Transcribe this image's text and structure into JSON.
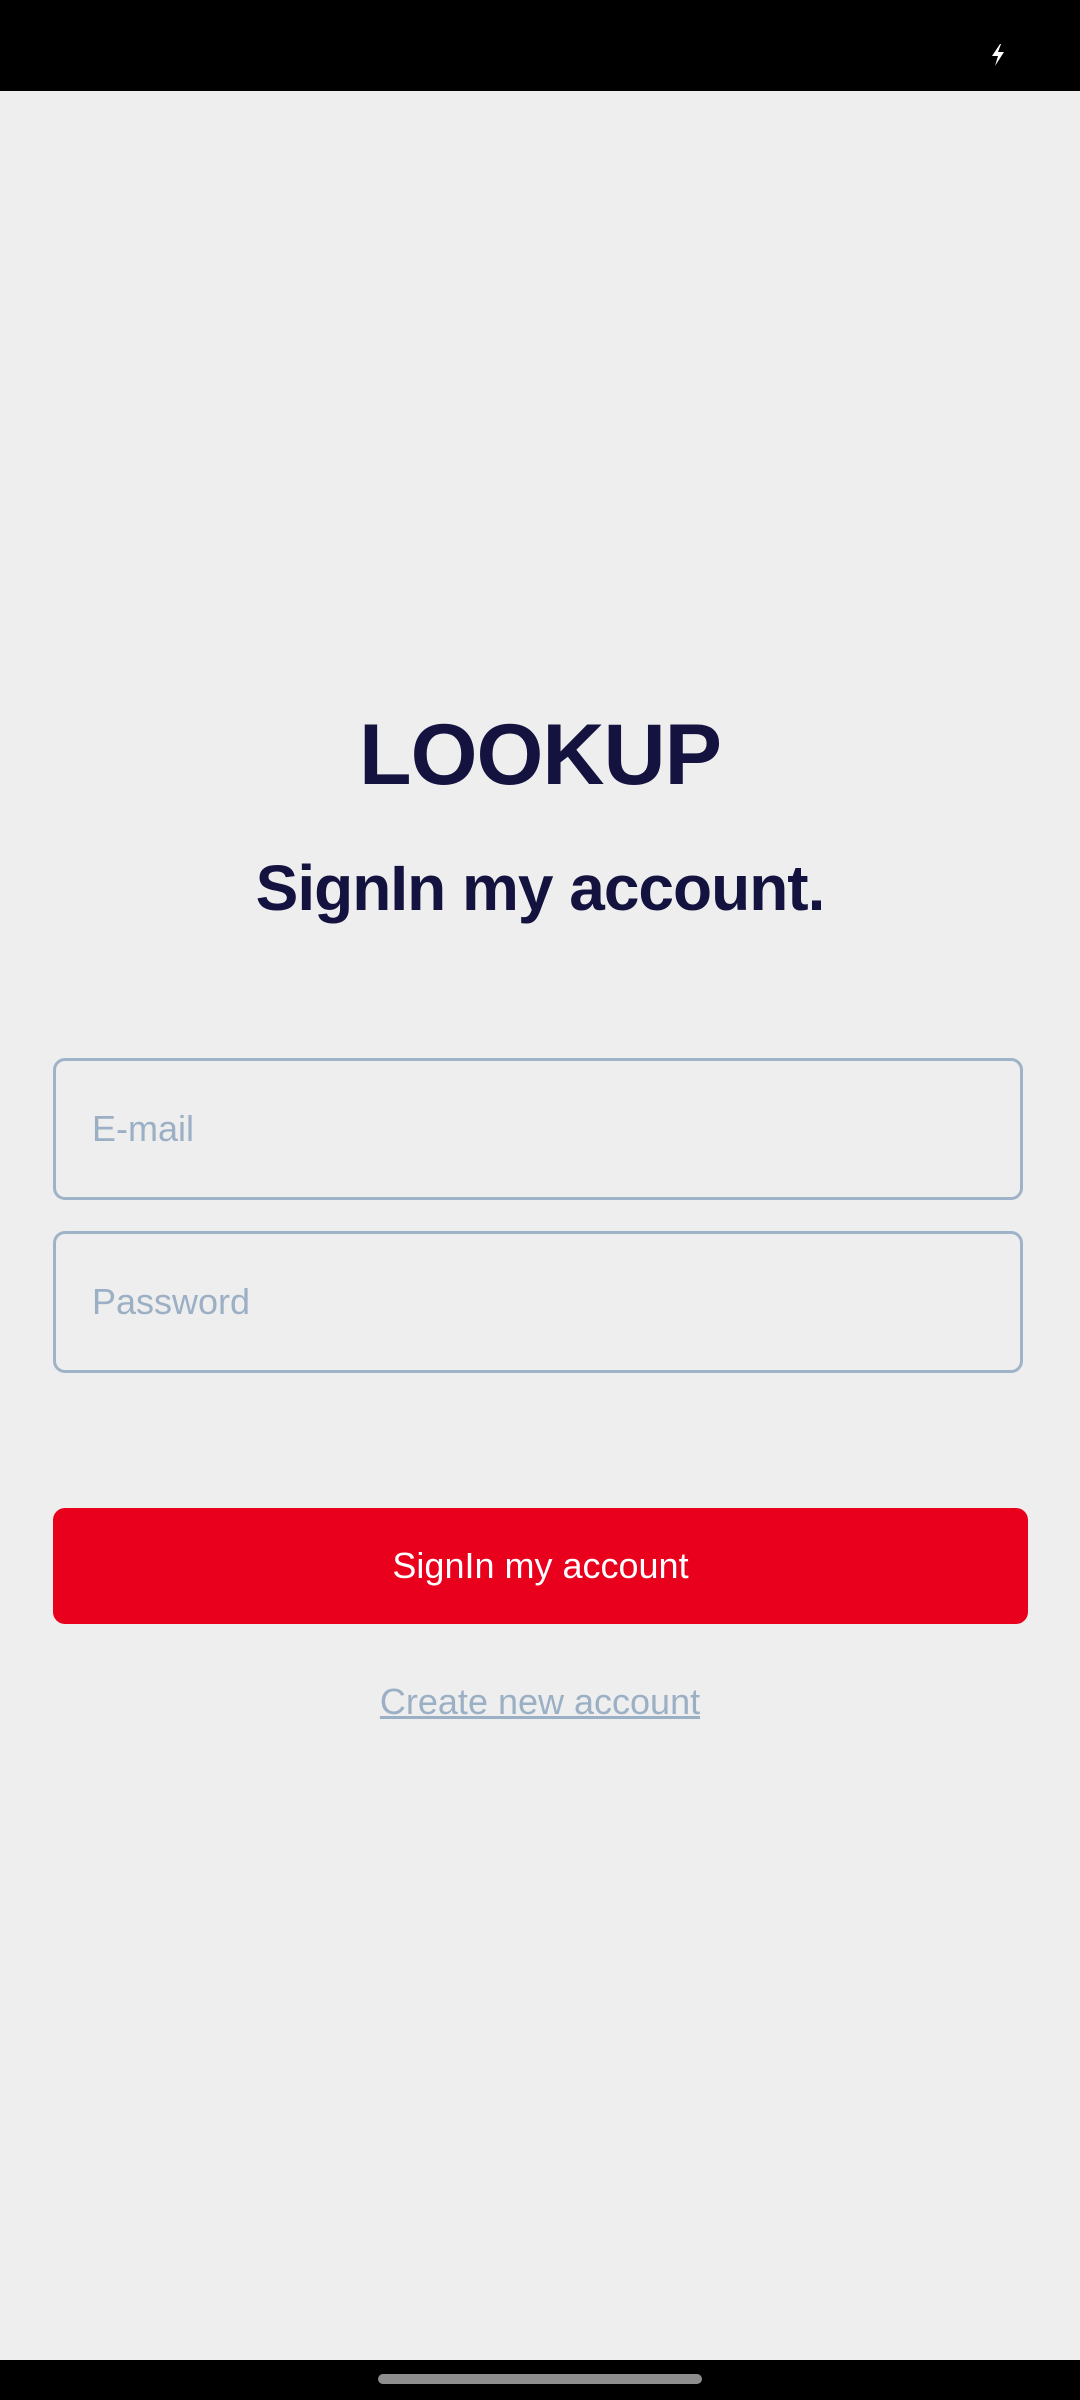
{
  "status_bar": {
    "icons": [
      "charging-icon"
    ]
  },
  "header": {
    "app_title": "LOOKUP",
    "subtitle": "SignIn my account."
  },
  "form": {
    "email": {
      "placeholder": "E-mail",
      "value": ""
    },
    "password": {
      "placeholder": "Password",
      "value": ""
    },
    "signin_label": "SignIn my account",
    "create_account_label": "Create new account"
  },
  "colors": {
    "background": "#eeeeee",
    "title": "#14123f",
    "primary_button": "#e8001c",
    "field_border": "#9fb3c8",
    "link": "#9cb0c5"
  }
}
